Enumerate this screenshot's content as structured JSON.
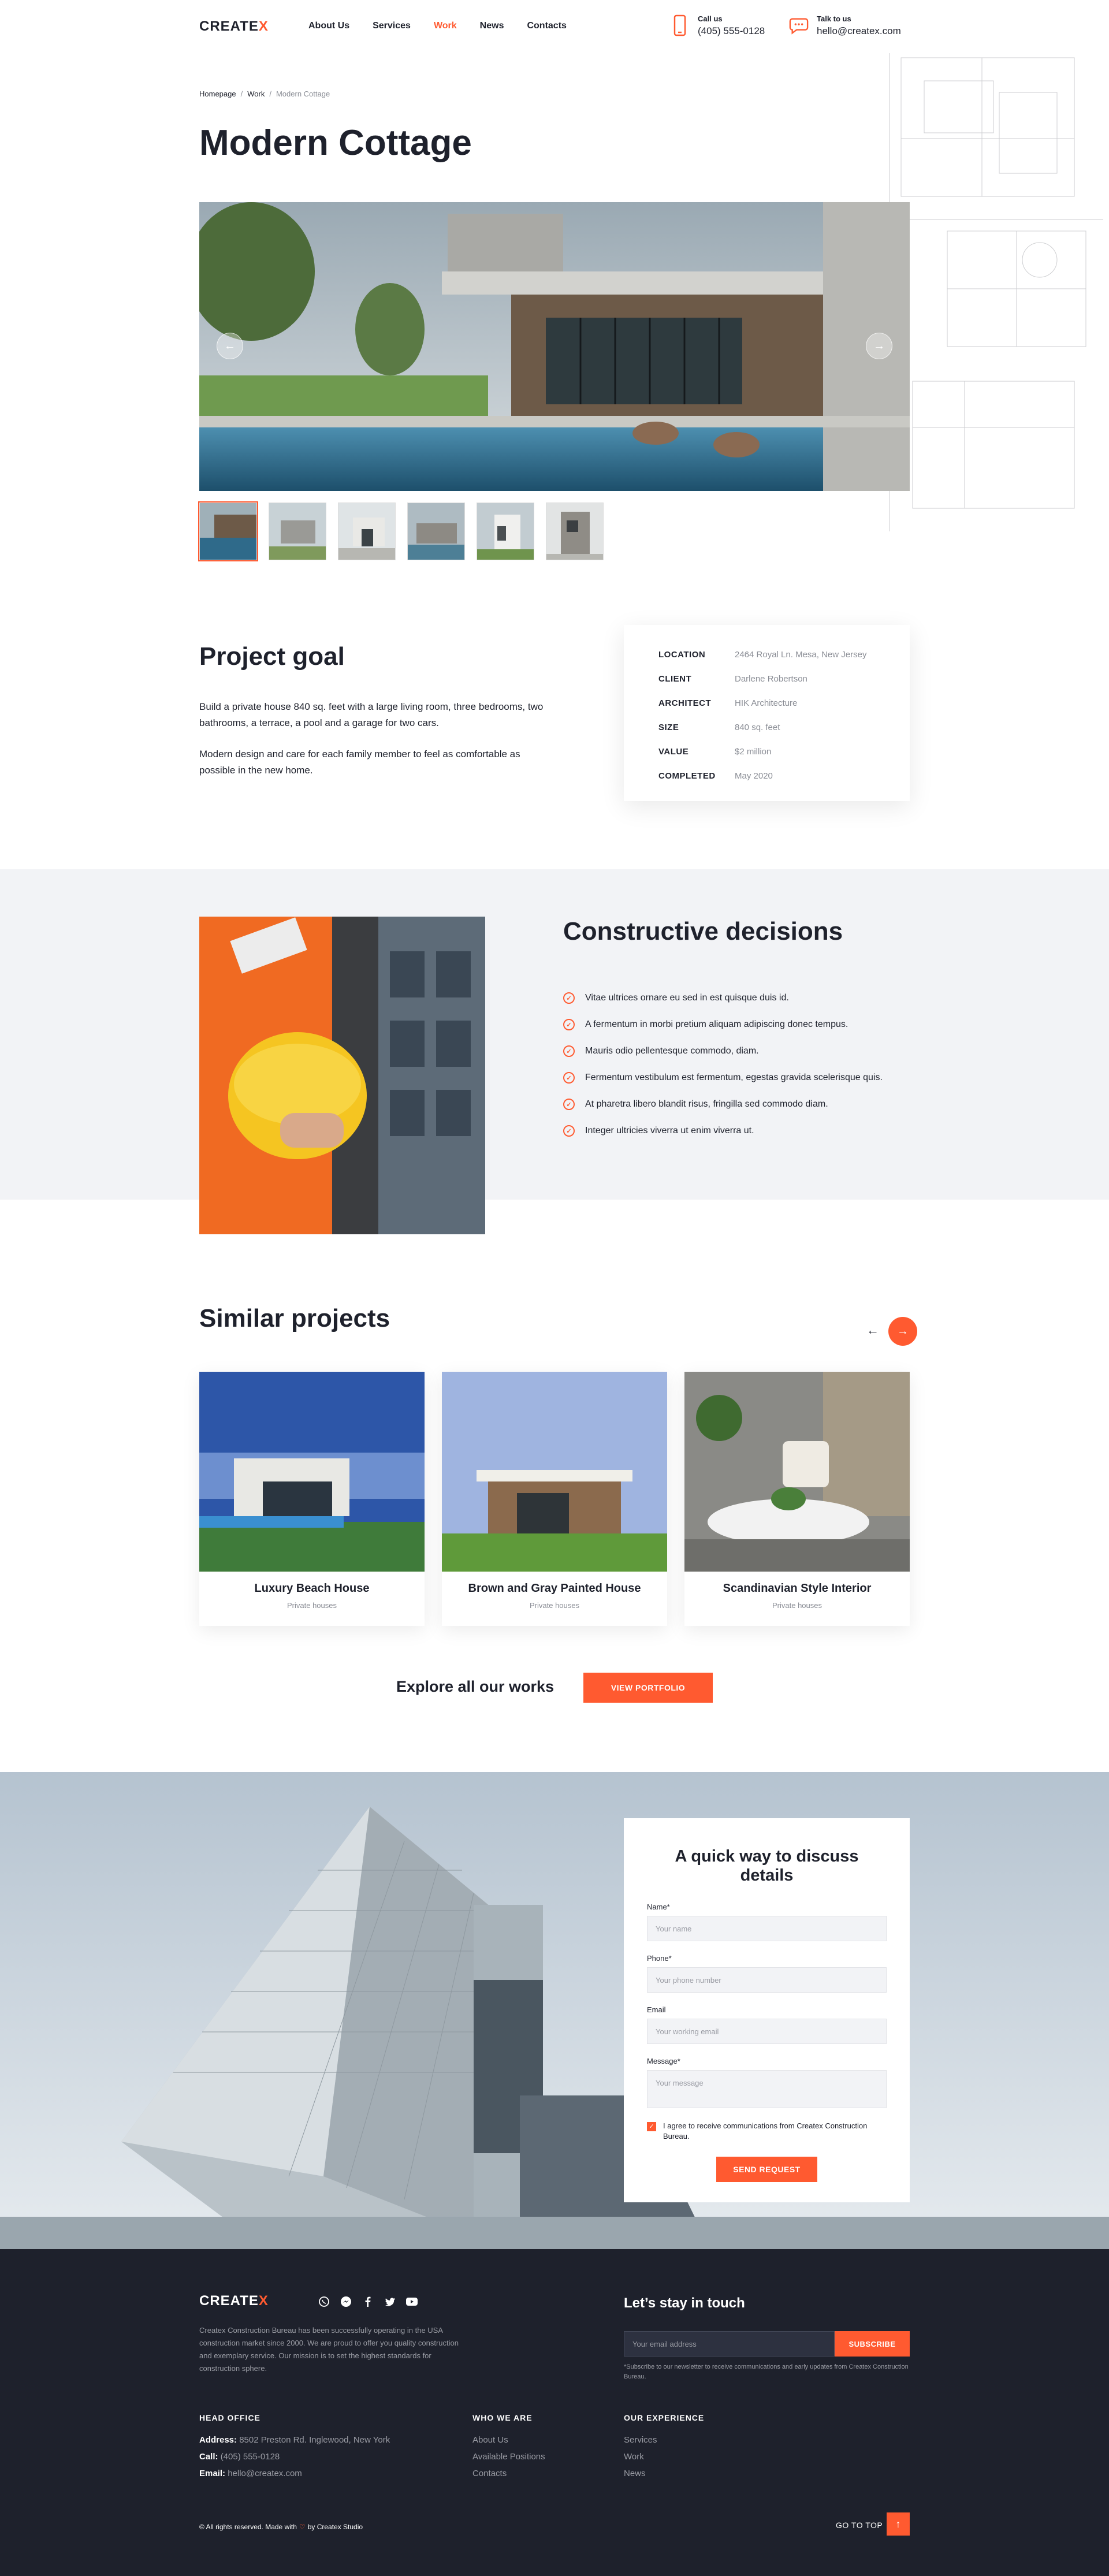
{
  "header": {
    "logo_text": "CREATE",
    "logo_x": "X",
    "nav": [
      {
        "label": "About Us"
      },
      {
        "label": "Services"
      },
      {
        "label": "Work"
      },
      {
        "label": "News"
      },
      {
        "label": "Contacts"
      }
    ],
    "active_nav": "Work",
    "call_label": "Call us",
    "call_value": "(405) 555-0128",
    "talk_label": "Talk to us",
    "talk_value": "hello@createx.com"
  },
  "breadcrumb": [
    "Homepage",
    "Work",
    "Modern Cottage"
  ],
  "page_title": "Modern Cottage",
  "gallery": {
    "slides": 6,
    "active": 0
  },
  "project_goal": {
    "title": "Project goal",
    "paragraphs": [
      "Build a private house 840 sq. feet with a large living room, three bedrooms, two bathrooms, a terrace, a pool and a garage for two cars.",
      "Modern design and care for each family member to feel as comfortable as possible in the new home."
    ]
  },
  "project_info": [
    {
      "key": "LOCATION",
      "value": "2464 Royal Ln. Mesa, New Jersey"
    },
    {
      "key": "CLIENT",
      "value": "Darlene Robertson"
    },
    {
      "key": "ARCHITECT",
      "value": "HIK Architecture"
    },
    {
      "key": "SIZE",
      "value": "840 sq. feet"
    },
    {
      "key": "VALUE",
      "value": "$2 million"
    },
    {
      "key": "COMPLETED",
      "value": "May 2020"
    }
  ],
  "decisions": {
    "title": "Constructive decisions",
    "items": [
      "Vitae ultrices ornare eu sed in est quisque duis id.",
      "A fermentum in morbi pretium aliquam adipiscing donec tempus.",
      "Mauris odio pellentesque commodo, diam.",
      "Fermentum vestibulum est fermentum, egestas gravida scelerisque quis.",
      "At pharetra libero blandit risus, fringilla sed commodo diam.",
      "Integer ultricies viverra ut enim viverra ut."
    ]
  },
  "similar": {
    "title": "Similar projects",
    "cards": [
      {
        "title": "Luxury Beach House",
        "category": "Private houses"
      },
      {
        "title": "Brown and Gray Painted House",
        "category": "Private houses"
      },
      {
        "title": "Scandinavian Style Interior",
        "category": "Private houses"
      }
    ],
    "explore_text": "Explore all our works",
    "portfolio_button": "VIEW PORTFOLIO"
  },
  "contact_form": {
    "title": "A quick way to discuss details",
    "fields": [
      {
        "label": "Name*",
        "placeholder": "Your name"
      },
      {
        "label": "Phone*",
        "placeholder": "Your phone number"
      },
      {
        "label": "Email",
        "placeholder": "Your working email"
      },
      {
        "label": "Message*",
        "placeholder": "Your message"
      }
    ],
    "agree": "I agree to receive communications from Createx Construction Bureau.",
    "agree_checked": true,
    "submit": "SEND REQUEST"
  },
  "footer": {
    "logo_text": "CREATE",
    "logo_x": "X",
    "socials": [
      "whatsapp-icon",
      "messenger-icon",
      "facebook-icon",
      "twitter-icon",
      "youtube-icon"
    ],
    "about": "Createx Construction Bureau has been successfully operating in the USA construction market since 2000. We are proud to offer you quality construction and exemplary service. Our mission is to set the highest standards for construction sphere.",
    "stay_title": "Let’s stay in touch",
    "email_placeholder": "Your email address",
    "subscribe": "SUBSCRIBE",
    "note": "*Subscribe to our newsletter to receive communications and early updates from Createx Construction Bureau.",
    "head_office": {
      "title": "HEAD OFFICE",
      "address_label": "Address:",
      "address": "8502 Preston Rd. Inglewood, New York",
      "call_label": "Call:",
      "call": "(405) 555-0128",
      "email_label": "Email:",
      "email": "hello@createx.com"
    },
    "who_we_are": {
      "title": "WHO WE ARE",
      "links": [
        "About Us",
        "Available Positions",
        "Contacts"
      ]
    },
    "experience": {
      "title": "OUR EXPERIENCE",
      "links": [
        "Services",
        "Work",
        "News"
      ]
    },
    "copyright_a": "© All rights reserved. Made with",
    "copyright_b": "by Createx Studio",
    "go_to_top": "GO TO TOP"
  },
  "colors": {
    "accent": "#ff5a30",
    "dark": "#1e212c",
    "gray_bg": "#f2f3f6",
    "muted": "#8a8d95"
  }
}
